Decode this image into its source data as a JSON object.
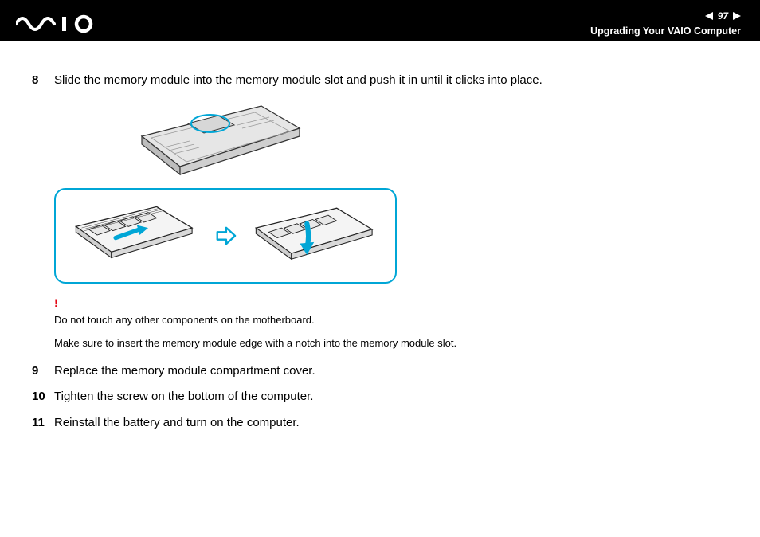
{
  "header": {
    "pageNumber": "97",
    "sectionTitle": "Upgrading Your VAIO Computer"
  },
  "steps": {
    "s8": {
      "num": "8",
      "text": "Slide the memory module into the memory module slot and push it in until it clicks into place."
    },
    "s9": {
      "num": "9",
      "text": "Replace the memory module compartment cover."
    },
    "s10": {
      "num": "10",
      "text": "Tighten the screw on the bottom of the computer."
    },
    "s11": {
      "num": "11",
      "text": "Reinstall the battery and turn on the computer."
    }
  },
  "warnings": {
    "bang": "!",
    "line1": "Do not touch any other components on the motherboard.",
    "line2": "Make sure to insert the memory module edge with a notch into the memory module slot."
  }
}
